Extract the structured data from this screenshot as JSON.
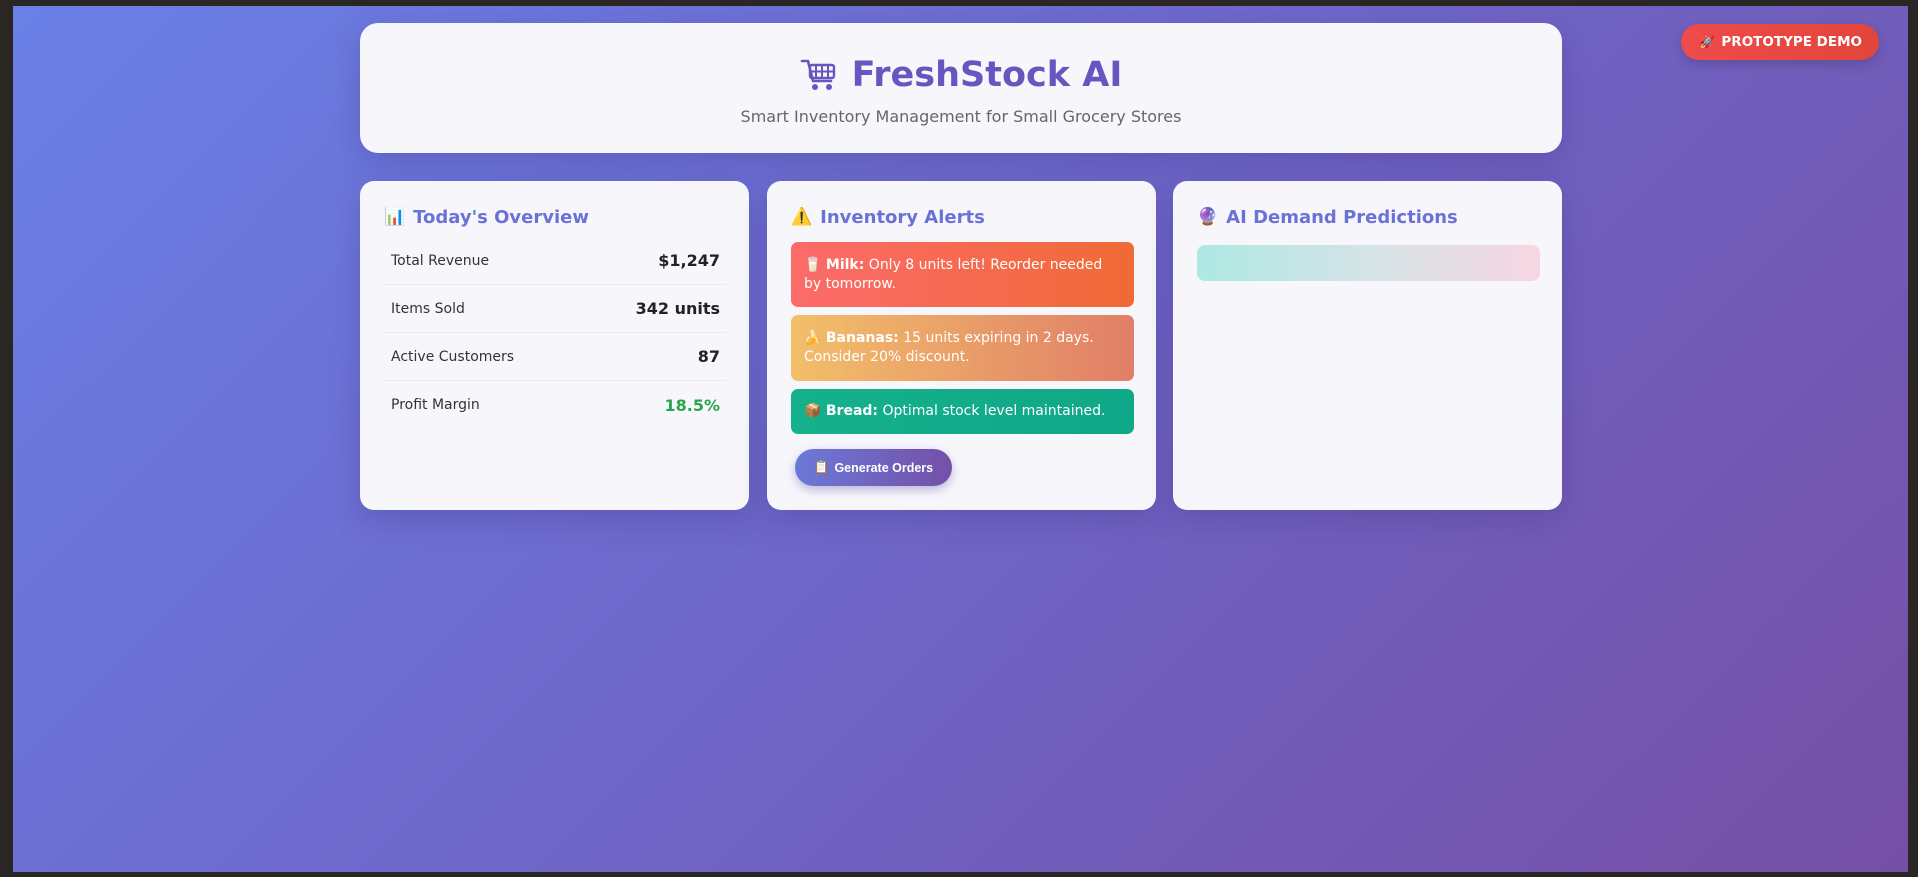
{
  "demo_badge": {
    "icon": "rocket-icon",
    "label": "PROTOTYPE DEMO"
  },
  "header": {
    "icon": "shopping-cart-icon",
    "title": "FreshStock AI",
    "subtitle": "Smart Inventory Management for Small Grocery Stores"
  },
  "overview": {
    "icon": "📊",
    "title": "Today's Overview",
    "rows": [
      {
        "label": "Total Revenue",
        "value": "$1,247"
      },
      {
        "label": "Items Sold",
        "value": "342 units"
      },
      {
        "label": "Active Customers",
        "value": "87"
      },
      {
        "label": "Profit Margin",
        "value": "18.5%"
      }
    ],
    "profit_color": "#29a64d"
  },
  "alerts": {
    "icon": "⚠️",
    "title": "Inventory Alerts",
    "items": [
      {
        "icon": "🥛",
        "name": "Milk:",
        "text": " Only 8 units left! Reorder needed by tomorrow."
      },
      {
        "icon": "🍌",
        "name": "Bananas:",
        "text": " 15 units expiring in 2 days. Consider 20% discount."
      },
      {
        "icon": "📦",
        "name": "Bread:",
        "text": " Optimal stock level maintained."
      }
    ],
    "button": {
      "icon": "📋",
      "label": "Generate Orders"
    }
  },
  "predictions": {
    "icon": "🔮",
    "title": "AI Demand Predictions"
  }
}
